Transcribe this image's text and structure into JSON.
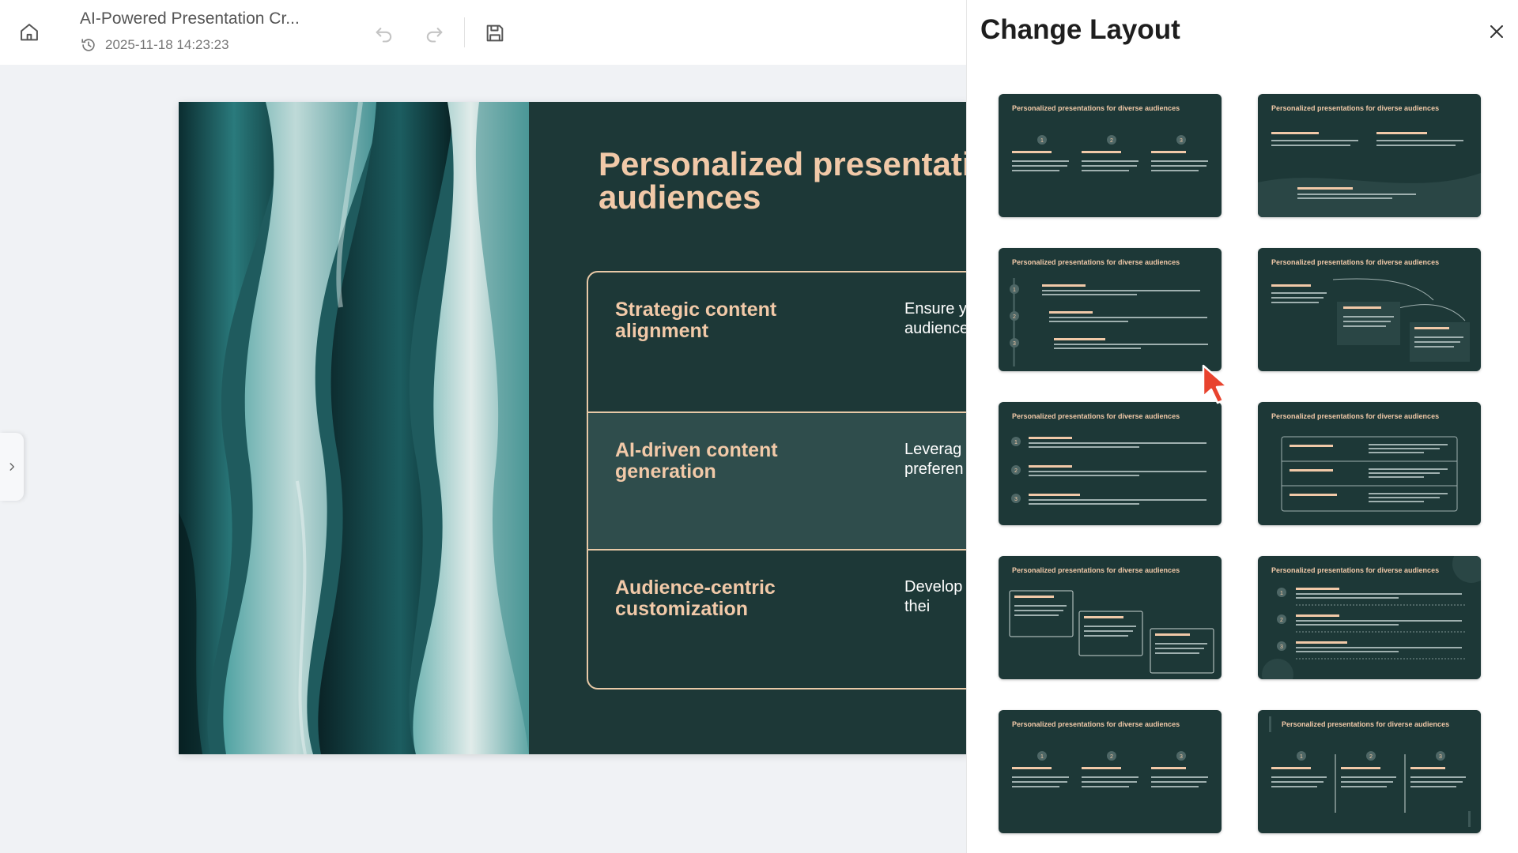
{
  "header": {
    "title": "AI-Powered Presentation Cr...",
    "timestamp": "2025-11-18 14:23:23"
  },
  "slide": {
    "title": "Personalized presentatio audiences",
    "rows": [
      {
        "label": "Strategic content alignment",
        "desc": "Ensure y aligned v knowled audience"
      },
      {
        "label": "AI-driven content generation",
        "desc": "Leverag tailored p various a preferen"
      },
      {
        "label": "Audience-centric customization",
        "desc": "Develop presenta to reson and thei"
      }
    ]
  },
  "panel": {
    "title": "Change Layout",
    "thumb_title": "Personalized presentations for diverse audiences",
    "layouts": [
      {
        "variant": "three-numbered-columns"
      },
      {
        "variant": "two-columns-wave"
      },
      {
        "variant": "vertical-timeline"
      },
      {
        "variant": "arc-steps"
      },
      {
        "variant": "numbered-list"
      },
      {
        "variant": "bordered-table"
      },
      {
        "variant": "staircase-boxes"
      },
      {
        "variant": "numbered-list-dotted"
      },
      {
        "variant": "three-numbered-columns"
      },
      {
        "variant": "three-columns-dividers"
      }
    ]
  },
  "colors": {
    "slide_bg": "#1d3837",
    "accent": "#f1c9a8",
    "row_highlight": "#2f4d4c",
    "cursor": "#e8432e"
  },
  "icons": {
    "home": "home-icon",
    "history": "history-clock-icon",
    "undo": "undo-icon",
    "redo": "redo-icon",
    "save": "save-icon",
    "close": "close-icon",
    "expand": "chevron-right-icon"
  }
}
